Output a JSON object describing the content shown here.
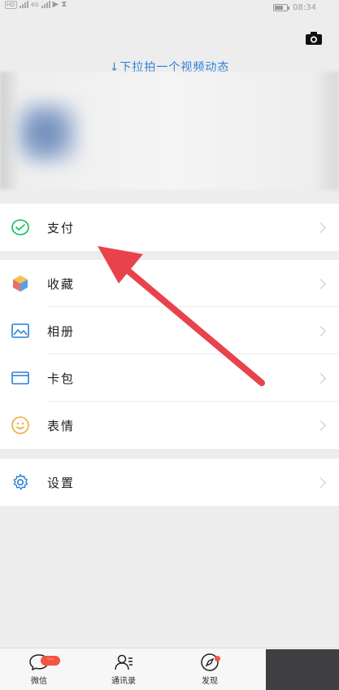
{
  "status_bar": {
    "network": "4G",
    "time": "08:34"
  },
  "profile": {
    "video_hint": "↓下拉拍一个视频动态"
  },
  "menu": {
    "pay": "支付",
    "favorites": "收藏",
    "album": "相册",
    "cards": "卡包",
    "stickers": "表情",
    "settings": "设置"
  },
  "bottom_nav": {
    "chats": "微信",
    "chats_badge": "···",
    "contacts": "通讯录",
    "discover": "发现"
  },
  "colors": {
    "pay_icon": "#07c160",
    "link_blue": "#2a7fd6",
    "annotation_arrow": "#e8434c",
    "badge": "#f25643"
  }
}
